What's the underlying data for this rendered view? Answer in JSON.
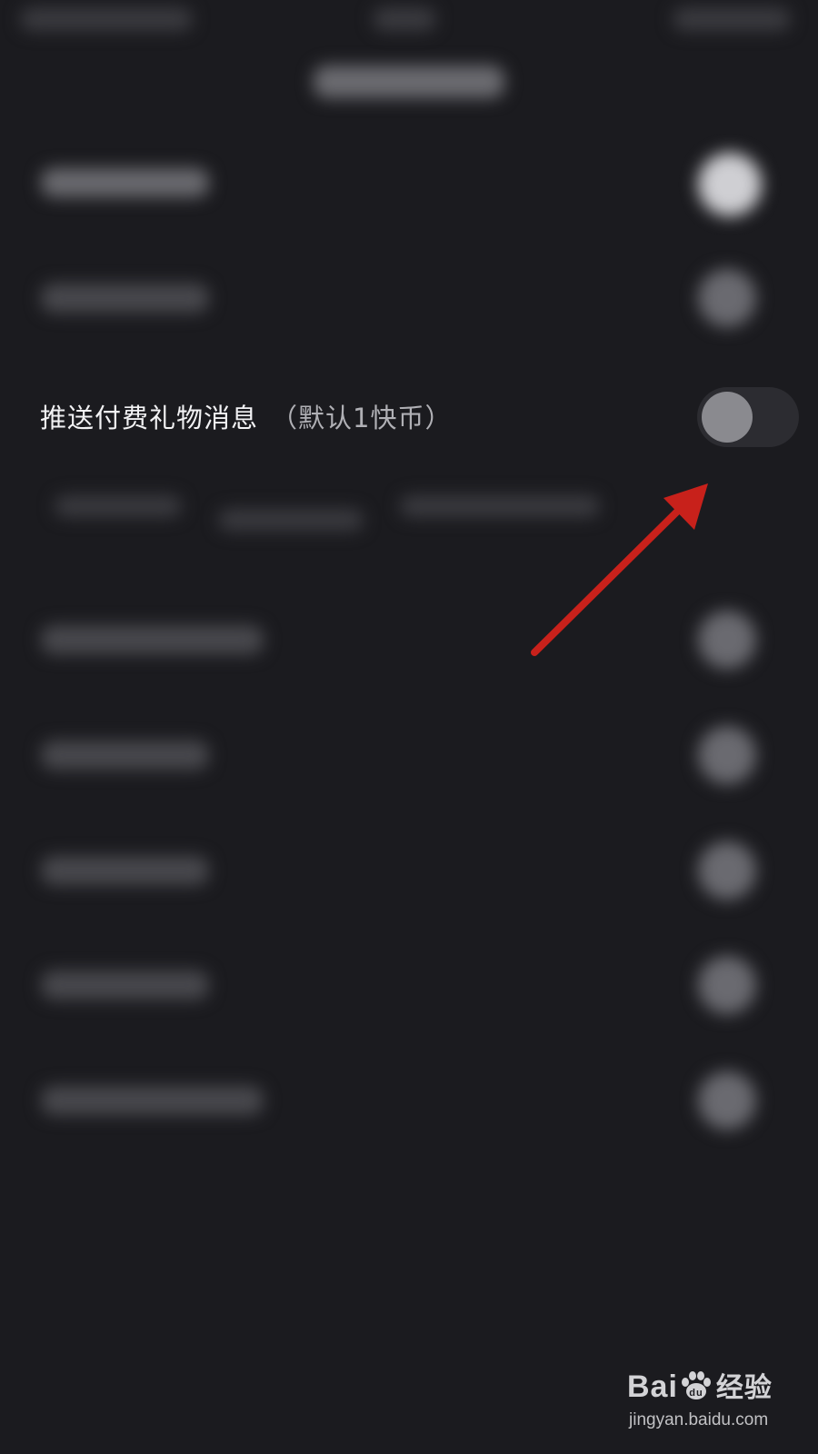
{
  "screen": {
    "background": "#1b1b1f"
  },
  "setting_row": {
    "title": "推送付费礼物消息",
    "hint": "（默认1快币）",
    "toggle_state": "off"
  },
  "annotation": {
    "arrow_color": "#c8211b",
    "points_to": "toggle-switch"
  },
  "watermark": {
    "brand": "Bai",
    "brand_suffix": "经验",
    "url": "jingyan.baidu.com"
  }
}
